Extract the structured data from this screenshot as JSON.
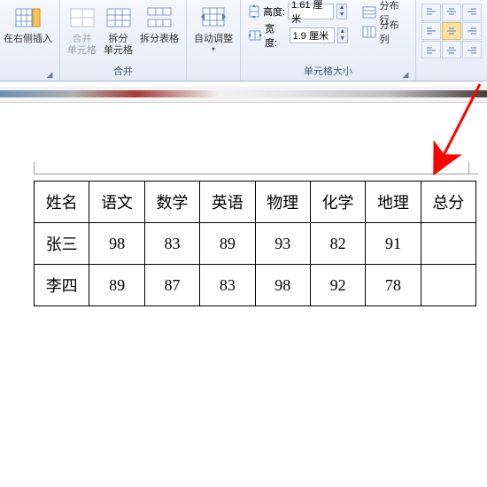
{
  "ribbon": {
    "insert_right": {
      "label": "在右侧插入"
    },
    "merge_group": {
      "merge_cells": "合并\n单元格",
      "split_cells": "拆分\n单元格",
      "split_table": "拆分表格",
      "label": "合并"
    },
    "autofit": {
      "label": "自动调整"
    },
    "cellsize": {
      "height_label": "高度:",
      "height_value": "1.61 厘米",
      "width_label": "宽度:",
      "width_value": "1.9 厘米",
      "group_label": "单元格大小",
      "dist_rows": "分布行",
      "dist_cols": "分布列"
    }
  },
  "table": {
    "headers": [
      "姓名",
      "语文",
      "数学",
      "英语",
      "物理",
      "化学",
      "地理",
      "总分"
    ],
    "rows": [
      {
        "name": "张三",
        "cells": [
          "98",
          "83",
          "89",
          "93",
          "82",
          "91",
          ""
        ]
      },
      {
        "name": "李四",
        "cells": [
          "89",
          "87",
          "83",
          "98",
          "92",
          "78",
          ""
        ]
      }
    ]
  }
}
